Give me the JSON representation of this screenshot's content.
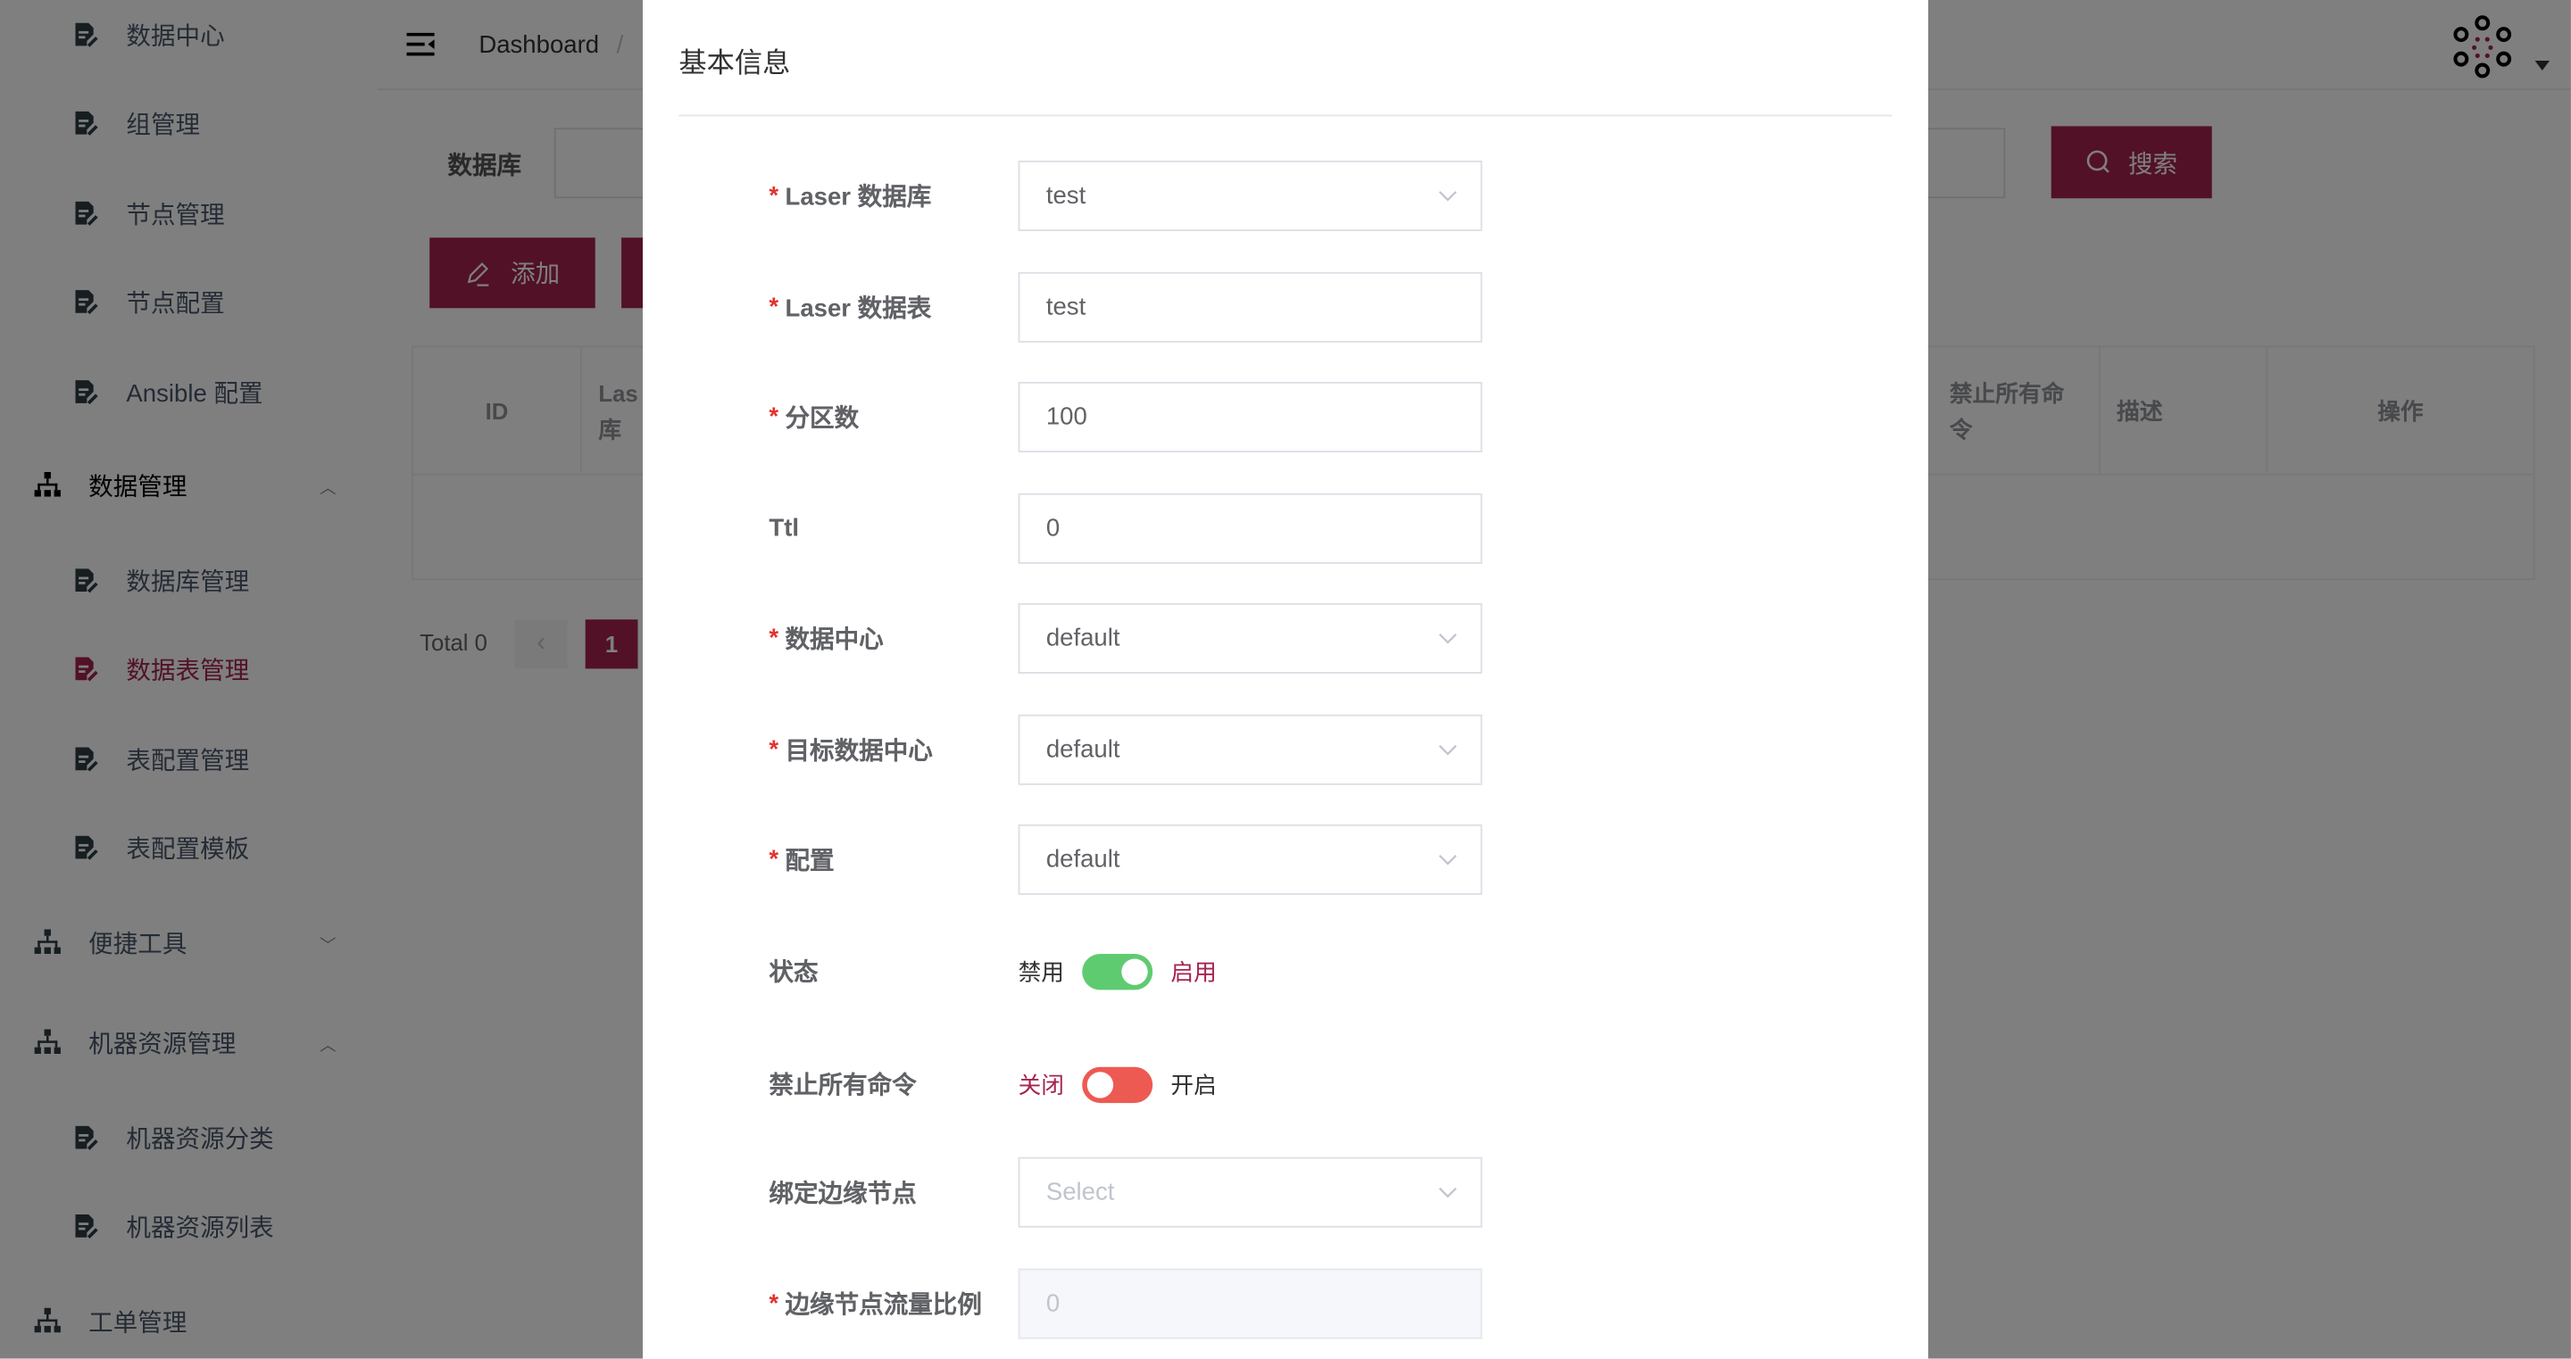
{
  "colors": {
    "brand": "#a5234d",
    "switch_on": "#5fcb71",
    "switch_off": "#ed5a52",
    "required": "#e2332f"
  },
  "sidebar": {
    "items": [
      {
        "label": "数据中心",
        "type": "sub",
        "icon": "document-edit-icon"
      },
      {
        "label": "组管理",
        "type": "sub",
        "icon": "document-edit-icon"
      },
      {
        "label": "节点管理",
        "type": "sub",
        "icon": "document-edit-icon"
      },
      {
        "label": "节点配置",
        "type": "sub",
        "icon": "document-edit-icon"
      },
      {
        "label": "Ansible 配置",
        "type": "sub",
        "icon": "document-edit-icon"
      },
      {
        "label": "数据管理",
        "type": "group",
        "icon": "sitemap-icon",
        "expanded": true
      },
      {
        "label": "数据库管理",
        "type": "sub",
        "icon": "document-edit-icon"
      },
      {
        "label": "数据表管理",
        "type": "sub",
        "icon": "document-edit-icon",
        "active": true
      },
      {
        "label": "表配置管理",
        "type": "sub",
        "icon": "document-edit-icon"
      },
      {
        "label": "表配置模板",
        "type": "sub",
        "icon": "document-edit-icon"
      },
      {
        "label": "便捷工具",
        "type": "group",
        "icon": "sitemap-icon",
        "expanded": false
      },
      {
        "label": "机器资源管理",
        "type": "group",
        "icon": "sitemap-icon",
        "expanded": true
      },
      {
        "label": "机器资源分类",
        "type": "sub",
        "icon": "document-edit-icon"
      },
      {
        "label": "机器资源列表",
        "type": "sub",
        "icon": "document-edit-icon"
      },
      {
        "label": "工单管理",
        "type": "group",
        "icon": "sitemap-icon"
      }
    ]
  },
  "header": {
    "breadcrumb": "Dashboard",
    "separator": "/"
  },
  "filter": {
    "label": "数据库",
    "search_label": "搜索"
  },
  "toolbar": {
    "add_label": "添加"
  },
  "table": {
    "columns": [
      "ID",
      "Las\n库",
      "禁止所有命令",
      "描述",
      "操作"
    ]
  },
  "pagination": {
    "total": "Total 0",
    "page": "1"
  },
  "modal": {
    "title": "基本信息",
    "fields": [
      {
        "label": "Laser 数据库",
        "required": true,
        "kind": "select",
        "value": "test"
      },
      {
        "label": "Laser 数据表",
        "required": true,
        "kind": "input",
        "value": "test"
      },
      {
        "label": "分区数",
        "required": true,
        "kind": "input",
        "value": "100"
      },
      {
        "label": "Ttl",
        "required": false,
        "kind": "input",
        "value": "0"
      },
      {
        "label": "数据中心",
        "required": true,
        "kind": "select",
        "value": "default"
      },
      {
        "label": "目标数据中心",
        "required": true,
        "kind": "select",
        "value": "default"
      },
      {
        "label": "配置",
        "required": true,
        "kind": "select",
        "value": "default"
      },
      {
        "label": "状态",
        "required": false,
        "kind": "switch",
        "off_label": "禁用",
        "on_label": "启用",
        "on": true
      },
      {
        "label": "禁止所有命令",
        "required": false,
        "kind": "switch",
        "off_label": "关闭",
        "on_label": "开启",
        "on": false
      },
      {
        "label": "绑定边缘节点",
        "required": false,
        "kind": "select",
        "placeholder": "Select"
      },
      {
        "label": "边缘节点流量比例",
        "required": true,
        "kind": "disabled",
        "value": "0"
      }
    ]
  }
}
